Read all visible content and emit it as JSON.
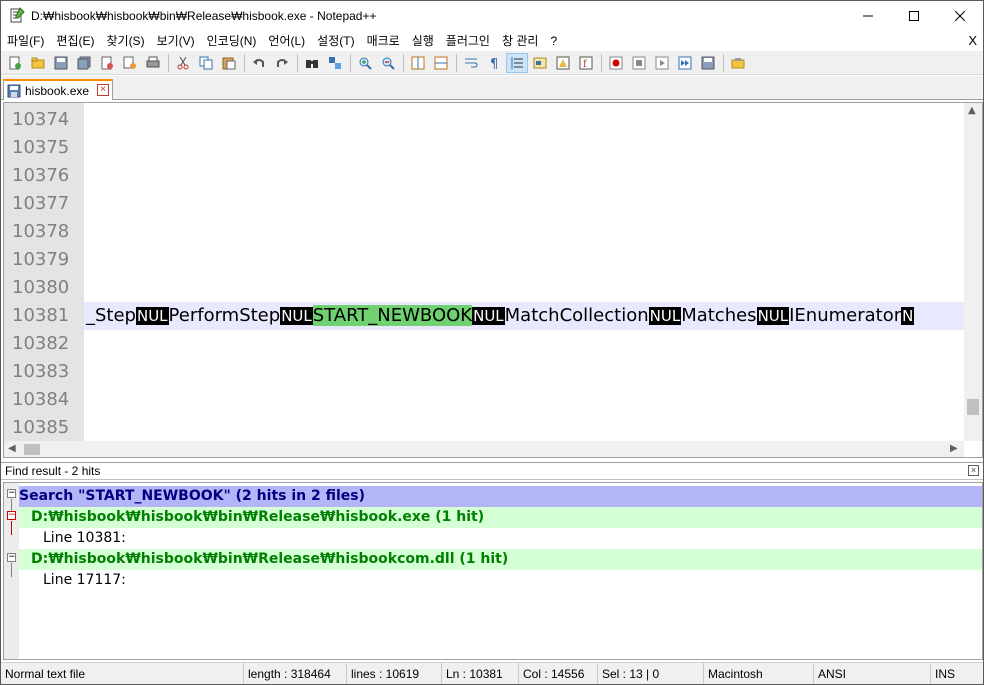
{
  "window": {
    "title": "D:₩hisbook₩hisbook₩bin₩Release₩hisbook.exe - Notepad++",
    "min_icon": "minimize-icon",
    "max_icon": "maximize-icon",
    "close_icon": "close-icon"
  },
  "menu": {
    "items": [
      "파일(F)",
      "편집(E)",
      "찾기(S)",
      "보기(V)",
      "인코딩(N)",
      "언어(L)",
      "설정(T)",
      "매크로",
      "실행",
      "플러그인",
      "창 관리",
      "?"
    ],
    "close_label": "X"
  },
  "tab": {
    "label": "hisbook.exe"
  },
  "editor": {
    "line_numbers": [
      "10374",
      "10375",
      "10376",
      "10377",
      "10378",
      "10379",
      "10380",
      "10381",
      "10382",
      "10383",
      "10384",
      "10385"
    ],
    "current_line": {
      "pre": "_Step",
      "nul": "NUL",
      "mid1": "PerformStep",
      "match": "START_NEWBOOK",
      "mid2": "MatchCollection",
      "mid3": "Matches",
      "tail": "IEnumerator",
      "tail_nul": "N"
    }
  },
  "find": {
    "header": "Find result - 2 hits",
    "search_line": "Search \"START_NEWBOOK\" (2 hits in 2 files)",
    "files": [
      {
        "path": "D:₩hisbook₩hisbook₩bin₩Release₩hisbook.exe (1 hit)",
        "hit": "Line 10381:"
      },
      {
        "path": "D:₩hisbook₩hisbook₩bin₩Release₩hisbookcom.dll (1 hit)",
        "hit": "Line 17117:"
      }
    ]
  },
  "status": {
    "file_type": "Normal text file",
    "length": "length : 318464",
    "lines": "lines : 10619",
    "ln": "Ln : 10381",
    "col": "Col : 14556",
    "sel": "Sel : 13 | 0",
    "eol": "Macintosh",
    "encoding": "ANSI",
    "mode": "INS"
  },
  "colors": {
    "match_highlight": "#6fd16f",
    "current_line": "#e8e8ff",
    "search_row": "#b4b4f8",
    "file_row": "#d5ffd5"
  }
}
